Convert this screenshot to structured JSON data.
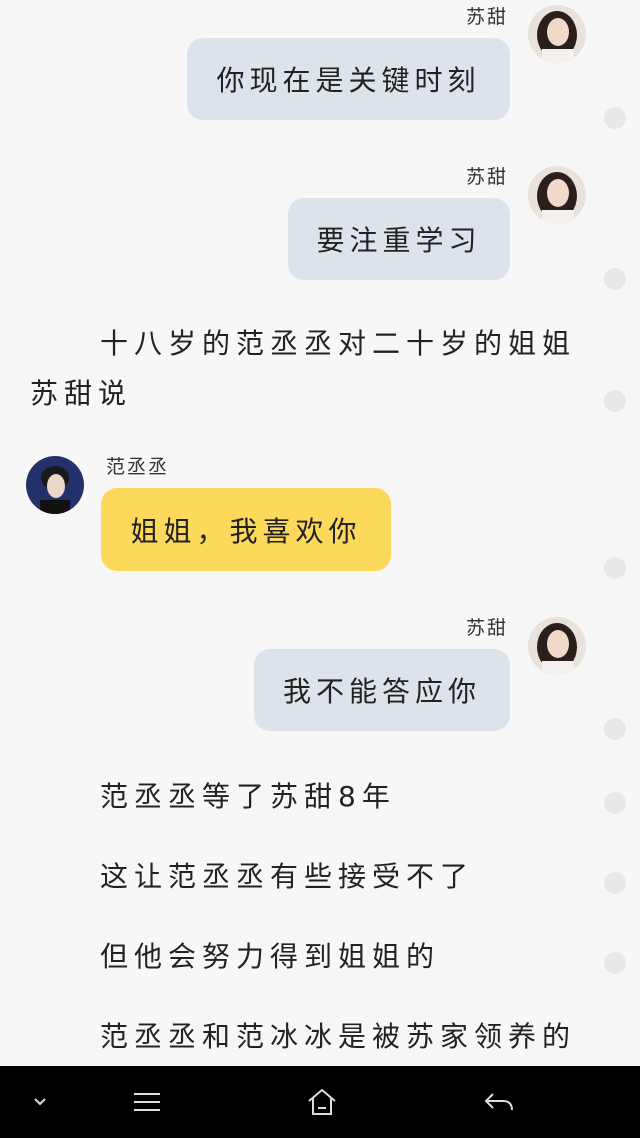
{
  "messages": [
    {
      "sender": "苏甜",
      "text": "你现在是关键时刻"
    },
    {
      "sender": "苏甜",
      "text": "要注重学习"
    },
    {
      "sender": "范丞丞",
      "text": "姐姐，我喜欢你"
    },
    {
      "sender": "苏甜",
      "text": "我不能答应你"
    }
  ],
  "narration": {
    "line1": "十八岁的范丞丞对二十岁的姐姐",
    "line2": "苏甜说",
    "line3": "范丞丞等了苏甜8年",
    "line4": "这让范丞丞有些接受不了",
    "line5": "但他会努力得到姐姐的",
    "line6": "范丞丞和范冰冰是被苏家领养的"
  },
  "nav": {
    "icons": [
      "chevron-down-icon",
      "menu-icon",
      "home-icon",
      "back-icon"
    ]
  },
  "colors": {
    "gray_bubble": "#dde3ea",
    "yellow_bubble": "#fcd95a",
    "navbar": "#000000"
  }
}
